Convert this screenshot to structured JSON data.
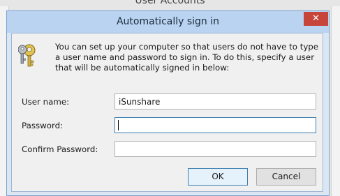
{
  "background_window": {
    "title": "User Accounts"
  },
  "dialog": {
    "title": "Automatically sign in",
    "close_glyph": "✕",
    "description": "You can set up your computer so that users do not have to type a user name and password to sign in. To do this, specify a user that will be automatically signed in below:",
    "icon": "keys-icon",
    "fields": {
      "user_name": {
        "label": "User name:",
        "value": "iSunshare"
      },
      "password": {
        "label": "Password:",
        "value": ""
      },
      "confirm_password": {
        "label": "Confirm Password:",
        "value": ""
      }
    },
    "buttons": {
      "ok": "OK",
      "cancel": "Cancel"
    }
  },
  "colors": {
    "titlebar": "#b9d3f0",
    "close_button": "#c7443a",
    "focus_border": "#3c7fb1"
  }
}
